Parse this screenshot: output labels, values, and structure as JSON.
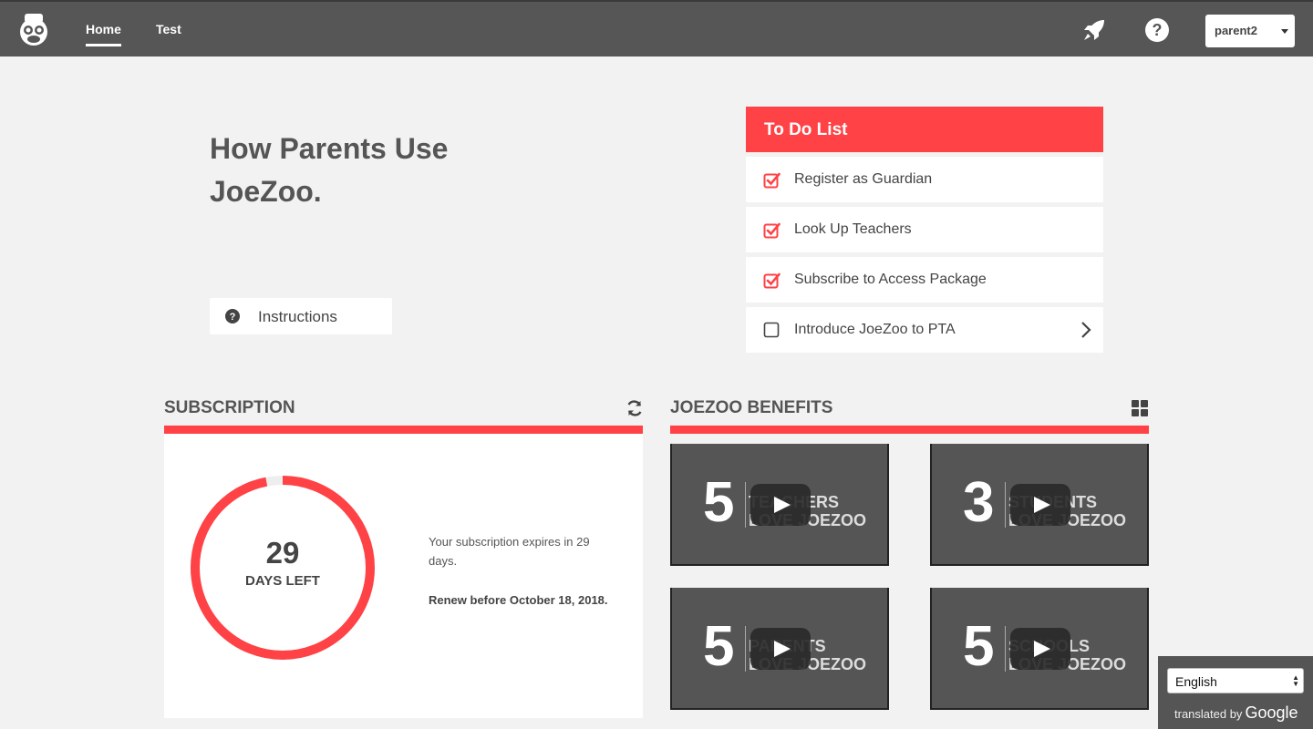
{
  "nav": {
    "home_label": "Home",
    "test_label": "Test",
    "user_label": "parent2"
  },
  "headline": {
    "line1": "How Parents Use",
    "line2": "JoeZoo."
  },
  "instructions_label": "Instructions",
  "todo": {
    "title": "To Do List",
    "items": [
      {
        "label": "Register as Guardian",
        "checked": true
      },
      {
        "label": "Look Up Teachers",
        "checked": true
      },
      {
        "label": "Subscribe to Access Package",
        "checked": true
      },
      {
        "label": "Introduce JoeZoo to PTA",
        "checked": false
      }
    ]
  },
  "subscription": {
    "title": "SUBSCRIPTION",
    "days": "29",
    "days_label": "DAYS LEFT",
    "progress_fraction": 0.97,
    "expires_text": "Your subscription expires in 29 days.",
    "renew_text": "Renew before October 18, 2018."
  },
  "benefits": {
    "title": "JOEZOO BENEFITS",
    "videos": [
      {
        "num": "5",
        "line1": "TEACHERS",
        "line2": "LOVE JOEZOO"
      },
      {
        "num": "3",
        "line1": "STUDENTS",
        "line2": "LOVE JOEZOO"
      },
      {
        "num": "5",
        "line1": "PARENTS",
        "line2": "LOVE JOEZOO"
      },
      {
        "num": "5",
        "line1": "SCHOOLS",
        "line2": "LOVE JOEZOO"
      }
    ]
  },
  "translate": {
    "language": "English",
    "translated_by": "translated by",
    "google": "Google"
  },
  "colors": {
    "accent": "#ff4245",
    "navbar": "#565656"
  },
  "icons": [
    "monkey-logo-icon",
    "rocket-icon",
    "help-icon",
    "question-circle-icon",
    "checkbox-checked-icon",
    "checkbox-empty-icon",
    "chevron-right-icon",
    "refresh-icon",
    "grid-icon",
    "play-icon"
  ]
}
